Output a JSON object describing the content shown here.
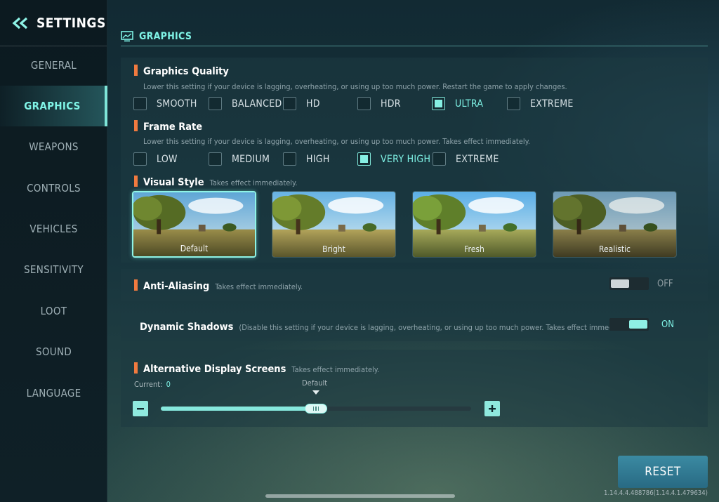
{
  "sidebar": {
    "title": "SETTINGS",
    "items": [
      {
        "label": "GENERAL"
      },
      {
        "label": "GRAPHICS",
        "active": true
      },
      {
        "label": "WEAPONS"
      },
      {
        "label": "CONTROLS"
      },
      {
        "label": "VEHICLES"
      },
      {
        "label": "SENSITIVITY"
      },
      {
        "label": "LOOT"
      },
      {
        "label": "SOUND"
      },
      {
        "label": "LANGUAGE"
      }
    ]
  },
  "header": {
    "title": "GRAPHICS",
    "icon": "monitor-icon"
  },
  "graphics_quality": {
    "title": "Graphics Quality",
    "desc": "Lower this setting if your device is lagging, overheating, or using up too much power. Restart the game to apply changes.",
    "options": [
      "SMOOTH",
      "BALANCED",
      "HD",
      "HDR",
      "ULTRA",
      "EXTREME"
    ],
    "selected": "ULTRA"
  },
  "frame_rate": {
    "title": "Frame Rate",
    "desc": "Lower this setting if your device is lagging, overheating, or using up too much power. Takes effect immediately.",
    "options": [
      "LOW",
      "MEDIUM",
      "HIGH",
      "VERY HIGH",
      "EXTREME"
    ],
    "selected": "VERY HIGH"
  },
  "visual_style": {
    "title": "Visual Style",
    "desc": "Takes effect immediately.",
    "options": [
      "Default",
      "Bright",
      "Fresh",
      "Realistic"
    ],
    "selected": "Default"
  },
  "anti_aliasing": {
    "title": "Anti-Aliasing",
    "desc": "Takes effect immediately.",
    "state": "OFF"
  },
  "dynamic_shadows": {
    "title": "Dynamic Shadows",
    "desc": "(Disable this setting if your device is lagging, overheating, or using up too much power. Takes effect immediately.)",
    "state": "ON"
  },
  "alt_display": {
    "title": "Alternative Display Screens",
    "desc": "Takes effect immediately.",
    "current_label": "Current:",
    "current_value": "0",
    "default_label": "Default",
    "slider_fraction": 0.5
  },
  "reset_label": "RESET",
  "version": "1.14.4.4.488786(1.14.4.1.479634)",
  "colors": {
    "accent": "#7ff3e6",
    "section_bar": "#f07a3f",
    "reset": "#2f7d96"
  }
}
